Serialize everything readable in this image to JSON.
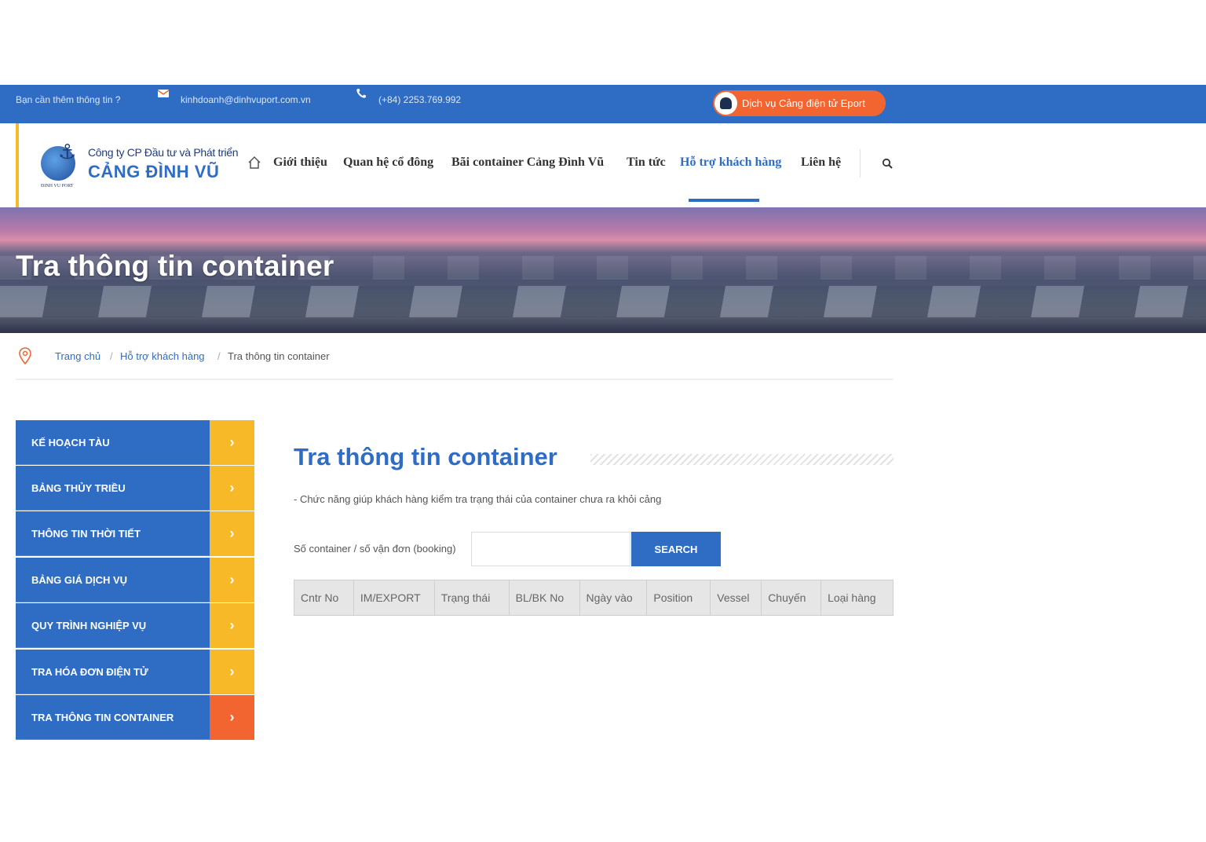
{
  "topbar": {
    "ask": "Bạn cần thêm thông tin ?",
    "email": "kinhdoanh@dinhvuport.com.vn",
    "phone": "(+84) 2253.769.992",
    "eport_label": "Dịch vụ Cảng điện tử Eport"
  },
  "brand": {
    "logo_text": "ĐINH VU PORT",
    "company_sub": "Công ty CP Đầu tư và Phát triển",
    "company_main": "CẢNG ĐÌNH VŨ"
  },
  "nav": {
    "items": [
      "Giới thiệu",
      "Quan hệ cổ đông",
      "Bãi container Cảng Đình Vũ",
      "Tin tức",
      "Hỗ trợ khách hàng",
      "Liên hệ"
    ],
    "active_index": 4
  },
  "banner": {
    "title": "Tra thông tin container"
  },
  "breadcrumb": {
    "items": [
      "Trang chủ",
      "Hỗ trợ khách hàng",
      "Tra thông tin container"
    ],
    "separator": "/"
  },
  "sidebar": {
    "items": [
      {
        "label": "KẾ HOẠCH TÀU"
      },
      {
        "label": "BẢNG THỦY TRIỀU"
      },
      {
        "label": "THÔNG TIN THỜI TIẾT"
      },
      {
        "label": "BẢNG GIÁ DỊCH VỤ"
      },
      {
        "label": "QUY TRÌNH NGHIỆP VỤ"
      },
      {
        "label": "TRA HÓA ĐƠN ĐIỆN TỬ"
      },
      {
        "label": "TRA THÔNG TIN CONTAINER"
      }
    ],
    "active_index": 6
  },
  "main": {
    "title": "Tra thông tin container",
    "description": "- Chức năng giúp khách hàng kiểm tra trạng thái của container chưa ra khỏi cảng",
    "form": {
      "label": "Số container / số vận đơn (booking)",
      "value": "",
      "button_label": "SEARCH"
    },
    "table": {
      "columns": [
        "Cntr No",
        "IM/EXPORT",
        "Trạng thái",
        "BL/BK No",
        "Ngày vào",
        "Position",
        "Vessel",
        "Chuyến",
        "Loại hàng"
      ]
    }
  },
  "colors": {
    "primary": "#2f6dc4",
    "accent_orange": "#f26531",
    "accent_yellow": "#f7b928"
  },
  "icons": [
    "mail-icon",
    "phone-icon",
    "ship-icon",
    "home-icon",
    "search-icon",
    "location-pin-icon",
    "chevron-right-icon"
  ]
}
